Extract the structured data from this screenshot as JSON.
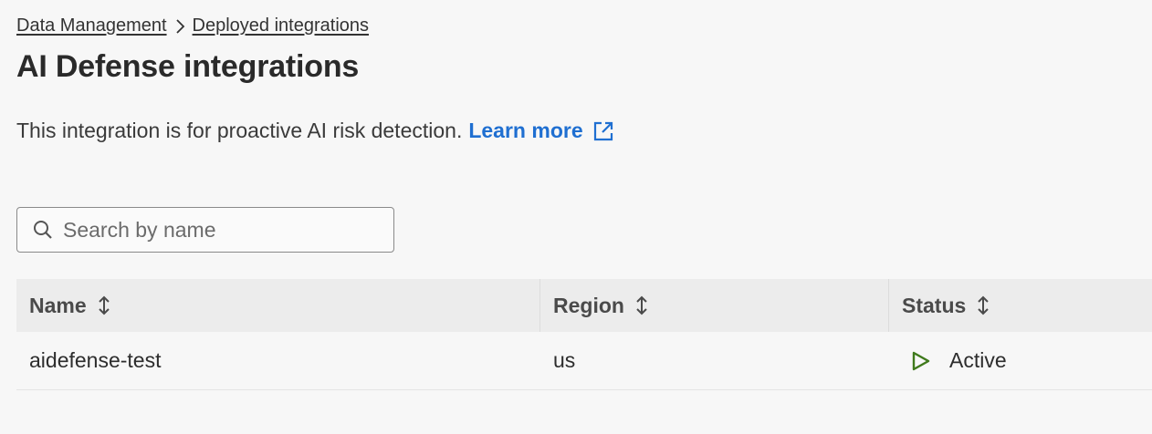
{
  "breadcrumb": {
    "items": [
      "Data Management",
      "Deployed integrations"
    ]
  },
  "page": {
    "title": "AI Defense integrations",
    "description": "This integration is for proactive AI risk detection.",
    "learn_more": "Learn more"
  },
  "search": {
    "placeholder": "Search by name",
    "value": ""
  },
  "table": {
    "columns": [
      "Name",
      "Region",
      "Status"
    ],
    "rows": [
      {
        "name": "aidefense-test",
        "region": "us",
        "status": "Active"
      }
    ]
  },
  "colors": {
    "link": "#1f6fd1",
    "status_active": "#3f7a1c",
    "header_bg": "#ececec",
    "page_bg": "#f7f7f7"
  },
  "icons": {
    "breadcrumb_separator": "chevron-right-icon",
    "external_link": "external-link-icon",
    "search": "search-icon",
    "sort": "sort-icon",
    "status": "play-icon"
  }
}
